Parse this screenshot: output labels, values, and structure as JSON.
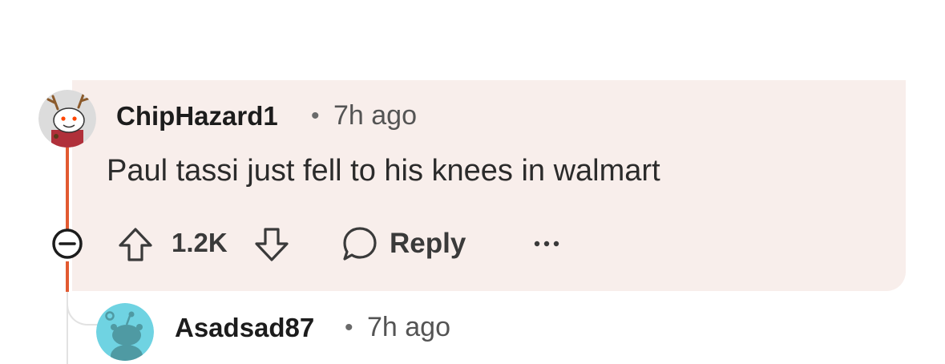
{
  "comment": {
    "author": "ChipHazard1",
    "separator": "•",
    "time": "7h ago",
    "body": "Paul tassi just fell to his knees in walmart",
    "votes": "1.2K",
    "reply_label": "Reply",
    "avatar_icon": "snoo-reindeer-avatar"
  },
  "reply": {
    "author": "Asadsad87",
    "separator": "•",
    "time": "7h ago",
    "avatar_icon": "snoo-default-avatar"
  },
  "colors": {
    "highlight_bg": "#f8eeeb",
    "thread_accent": "#e25a31",
    "thread_gray": "#e2e2e2",
    "reply_avatar_bg": "#6fd3e2"
  }
}
